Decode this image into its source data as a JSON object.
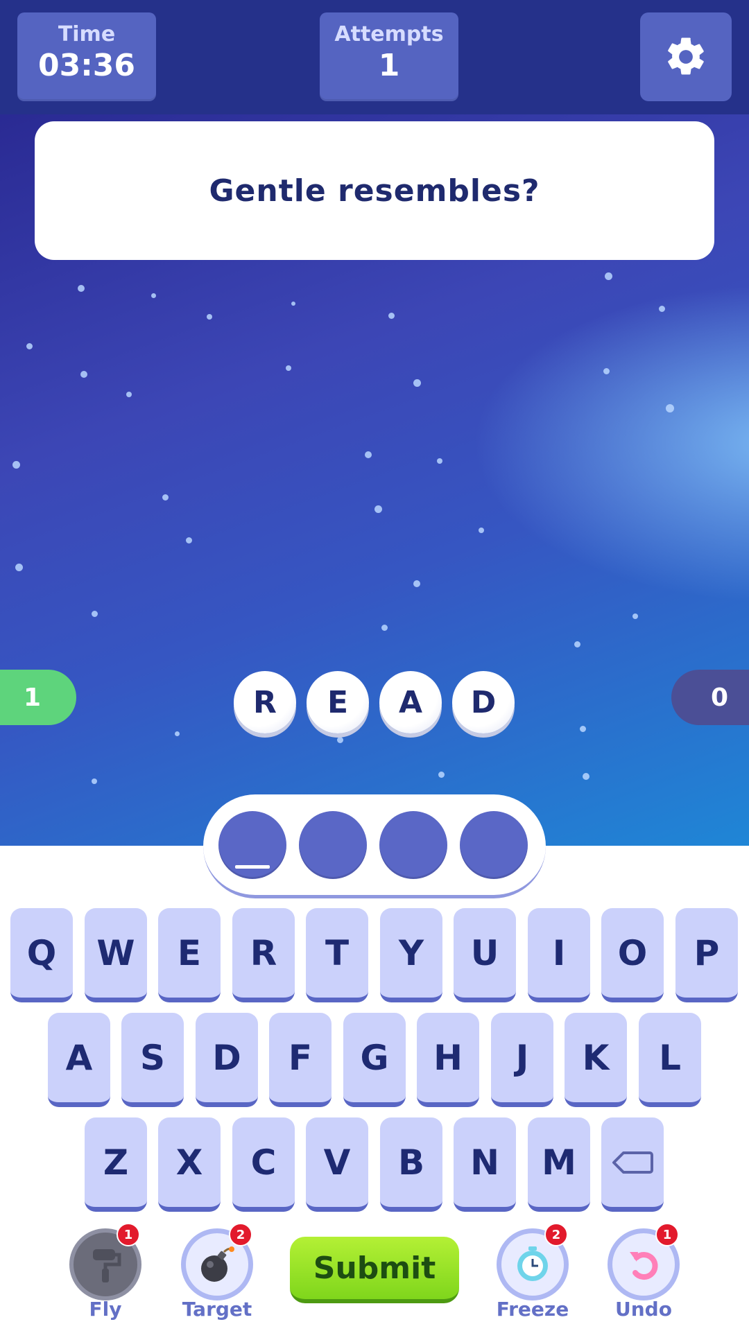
{
  "header": {
    "time_label": "Time",
    "time_value": "03:36",
    "attempts_label": "Attempts",
    "attempts_value": "1",
    "settings_icon": "gear-icon"
  },
  "question": "Gentle resembles?",
  "scores": {
    "left": "1",
    "right": "0"
  },
  "letter_bank": [
    "R",
    "E",
    "A",
    "D"
  ],
  "answer_slots": 4,
  "keyboard": {
    "row1": [
      "Q",
      "W",
      "E",
      "R",
      "T",
      "Y",
      "U",
      "I",
      "O",
      "P"
    ],
    "row2": [
      "A",
      "S",
      "D",
      "F",
      "G",
      "H",
      "J",
      "K",
      "L"
    ],
    "row3": [
      "Z",
      "X",
      "C",
      "V",
      "B",
      "N",
      "M"
    ],
    "backspace_icon": "backspace-icon"
  },
  "powerups": {
    "fly": {
      "label": "Fly",
      "count": "1",
      "icon": "paint-roller-icon"
    },
    "target": {
      "label": "Target",
      "count": "2",
      "icon": "bomb-icon"
    },
    "freeze": {
      "label": "Freeze",
      "count": "2",
      "icon": "frozen-clock-icon"
    },
    "undo": {
      "label": "Undo",
      "count": "1",
      "icon": "undo-arrow-icon"
    }
  },
  "submit_label": "Submit",
  "colors": {
    "header_bg": "#25318a",
    "stat_box": "#5564c1",
    "key_face": "#cbd1fb",
    "submit_green": "#8fdd22",
    "badge_red": "#e21a2c"
  }
}
